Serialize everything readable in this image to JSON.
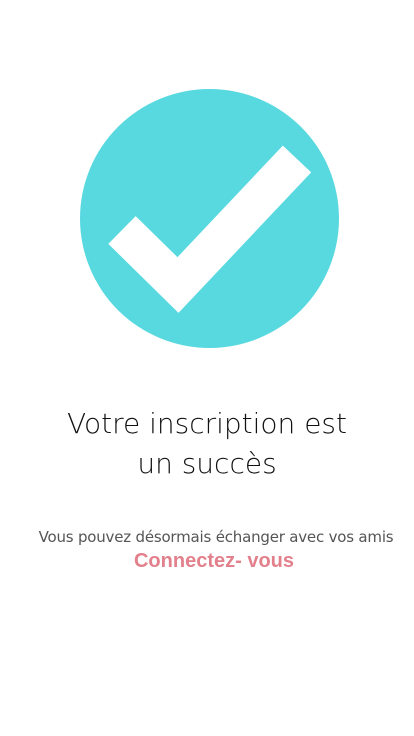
{
  "colors": {
    "accent_teal": "#58d9e0",
    "link_pink": "#e2808c",
    "title_text": "#111111",
    "subtitle_text": "#555555",
    "background": "#ffffff"
  },
  "icon": {
    "name": "checkmark-circle-icon"
  },
  "confirmation": {
    "title_line_1": "Votre inscription est",
    "title_line_2": "un succès",
    "subtitle": "Vous pouvez désormais échanger avec vos amis",
    "login_link_label": "Connectez- vous"
  }
}
